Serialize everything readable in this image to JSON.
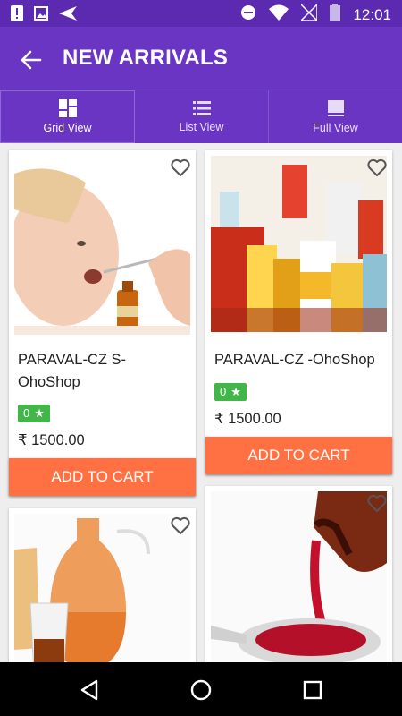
{
  "status": {
    "time": "12:01"
  },
  "header": {
    "title": "NEW ARRIVALS"
  },
  "tabs": [
    {
      "label": "Grid View",
      "icon": "grid-view-icon"
    },
    {
      "label": "List View",
      "icon": "list-view-icon"
    },
    {
      "label": "Full View",
      "icon": "full-view-icon"
    }
  ],
  "products": [
    {
      "name": "PARAVAL-CZ S-OhoShop",
      "rating": "0",
      "price": "₹ 1500.00",
      "button": "ADD TO CART"
    },
    {
      "name": "PARAVAL-CZ -OhoShop",
      "rating": "0",
      "price": "₹ 1500.00",
      "button": "ADD TO CART"
    }
  ],
  "colors": {
    "primary": "#6a35c2",
    "primary_dark": "#5b2ab0",
    "accent": "#ff7043",
    "rating": "#43b649"
  }
}
